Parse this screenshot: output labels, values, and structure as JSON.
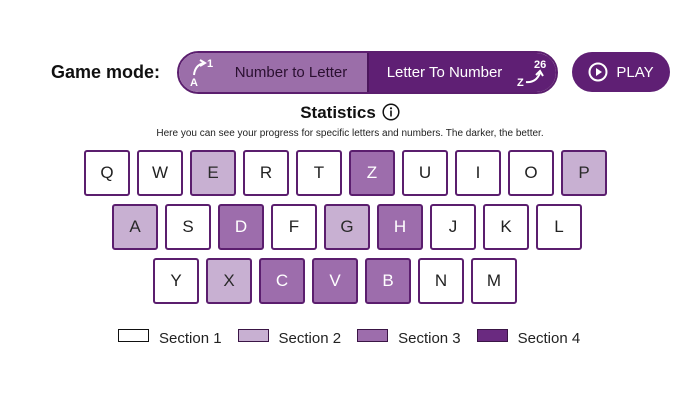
{
  "header": {
    "mode_label": "Game mode:",
    "modes": [
      {
        "label": "Number to Letter",
        "icon": "a-to-1-icon",
        "icon_letter": "A",
        "icon_number": "1"
      },
      {
        "label": "Letter To Number",
        "icon": "z-to-26-icon",
        "icon_letter": "Z",
        "icon_number": "26"
      }
    ],
    "play_label": "PLAY"
  },
  "statistics": {
    "title": "Statistics",
    "description": "Here you can see your progress for specific letters and numbers. The darker, the better."
  },
  "keyboard": {
    "rows": [
      [
        {
          "key": "Q",
          "section": 1
        },
        {
          "key": "W",
          "section": 1
        },
        {
          "key": "E",
          "section": 2
        },
        {
          "key": "R",
          "section": 1
        },
        {
          "key": "T",
          "section": 1
        },
        {
          "key": "Z",
          "section": 3
        },
        {
          "key": "U",
          "section": 1
        },
        {
          "key": "I",
          "section": 1
        },
        {
          "key": "O",
          "section": 1
        },
        {
          "key": "P",
          "section": 2
        }
      ],
      [
        {
          "key": "A",
          "section": 2
        },
        {
          "key": "S",
          "section": 1
        },
        {
          "key": "D",
          "section": 3
        },
        {
          "key": "F",
          "section": 1
        },
        {
          "key": "G",
          "section": 2
        },
        {
          "key": "H",
          "section": 3
        },
        {
          "key": "J",
          "section": 1
        },
        {
          "key": "K",
          "section": 1
        },
        {
          "key": "L",
          "section": 1
        }
      ],
      [
        {
          "key": "Y",
          "section": 1
        },
        {
          "key": "X",
          "section": 2
        },
        {
          "key": "C",
          "section": 3
        },
        {
          "key": "V",
          "section": 3
        },
        {
          "key": "B",
          "section": 3
        },
        {
          "key": "N",
          "section": 1
        },
        {
          "key": "M",
          "section": 1
        }
      ]
    ]
  },
  "legend": [
    {
      "label": "Section 1",
      "section": 1
    },
    {
      "label": "Section 2",
      "section": 2
    },
    {
      "label": "Section 3",
      "section": 3
    },
    {
      "label": "Section 4",
      "section": 4
    }
  ],
  "colors": {
    "section_1": "#ffffff",
    "section_2": "#c8b0d2",
    "section_3": "#9d6dac",
    "section_4": "#6a2a80",
    "accent": "#5f1f74"
  }
}
